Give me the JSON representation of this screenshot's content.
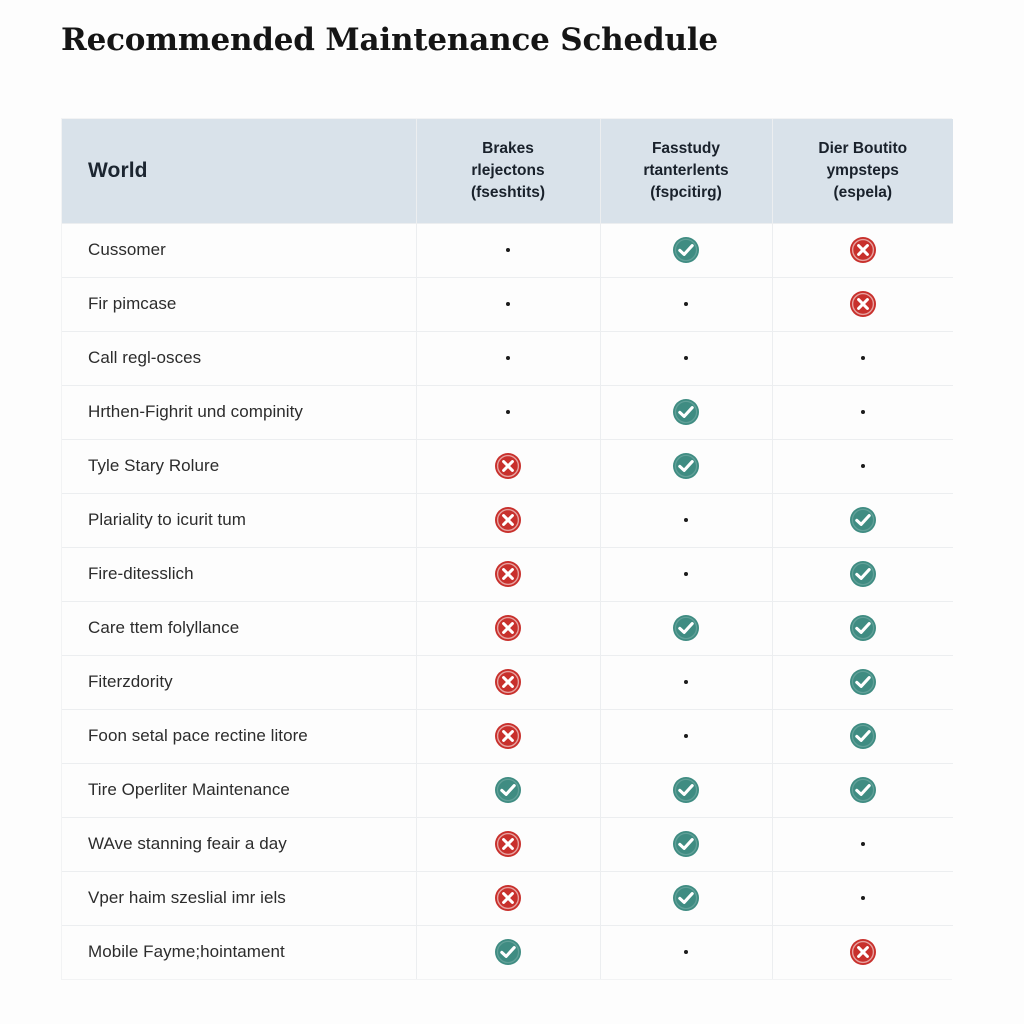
{
  "title": "Recommended Maintenance Schedule",
  "colors": {
    "page_background": "#fdfdfd",
    "header_background": "#d9e2ea",
    "grid_line": "#eceef0",
    "check_fill": "#3f8c82",
    "cross_fill": "#c8302c",
    "text": "#2c2c2c",
    "title_text": "#151515"
  },
  "table": {
    "columns": [
      {
        "id": "world",
        "label": "World",
        "lines": [
          "World"
        ],
        "align": "left"
      },
      {
        "id": "brakes",
        "label": "Brakes rlejectons (fseshtits)",
        "lines": [
          "Brakes",
          "rlejectons",
          "(fseshtits)"
        ],
        "align": "center"
      },
      {
        "id": "fasstudy",
        "label": "Fasstudy rtanterlents (fspcitirg)",
        "lines": [
          "Fasstudy",
          "rtanterlents",
          "(fspcitirg)"
        ],
        "align": "center"
      },
      {
        "id": "dier-boutito",
        "label": "Dier Boutito ympsteps (espela)",
        "lines": [
          "Dier Boutito",
          "ympsteps",
          "(espela)"
        ],
        "align": "center"
      }
    ],
    "marks": {
      "check": "check-circle-icon",
      "cross": "cross-circle-icon",
      "dot": "dot-icon"
    },
    "rows": [
      {
        "label": "Cussomer",
        "cells": [
          "dot",
          "check",
          "cross"
        ]
      },
      {
        "label": "Fir pimcase",
        "cells": [
          "dot",
          "dot",
          "cross"
        ]
      },
      {
        "label": "Call regl-osces",
        "cells": [
          "dot",
          "dot",
          "dot"
        ]
      },
      {
        "label": "Hrthen-Fighrit und compinity",
        "cells": [
          "dot",
          "check",
          "dot"
        ]
      },
      {
        "label": "Tyle Stary Rolure",
        "cells": [
          "cross",
          "check",
          "dot"
        ]
      },
      {
        "label": "Plariality to icurit tum",
        "cells": [
          "cross",
          "dot",
          "check"
        ]
      },
      {
        "label": "Fire-ditesslich",
        "cells": [
          "cross",
          "dot",
          "check"
        ]
      },
      {
        "label": "Care ttem folyllance",
        "cells": [
          "cross",
          "check",
          "check"
        ]
      },
      {
        "label": "Fiterzdority",
        "cells": [
          "cross",
          "dot",
          "check"
        ]
      },
      {
        "label": "Foon setal pace rectine litore",
        "cells": [
          "cross",
          "dot",
          "check"
        ]
      },
      {
        "label": "Tire Operliter Maintenance",
        "cells": [
          "check",
          "check",
          "check"
        ]
      },
      {
        "label": "WAve stanning feair a day",
        "cells": [
          "cross",
          "check",
          "dot"
        ]
      },
      {
        "label": "Vper haim szeslial imr iels",
        "cells": [
          "cross",
          "check",
          "dot"
        ]
      },
      {
        "label": "Mobile Fayme;hointament",
        "cells": [
          "check",
          "dot",
          "cross"
        ]
      }
    ]
  }
}
